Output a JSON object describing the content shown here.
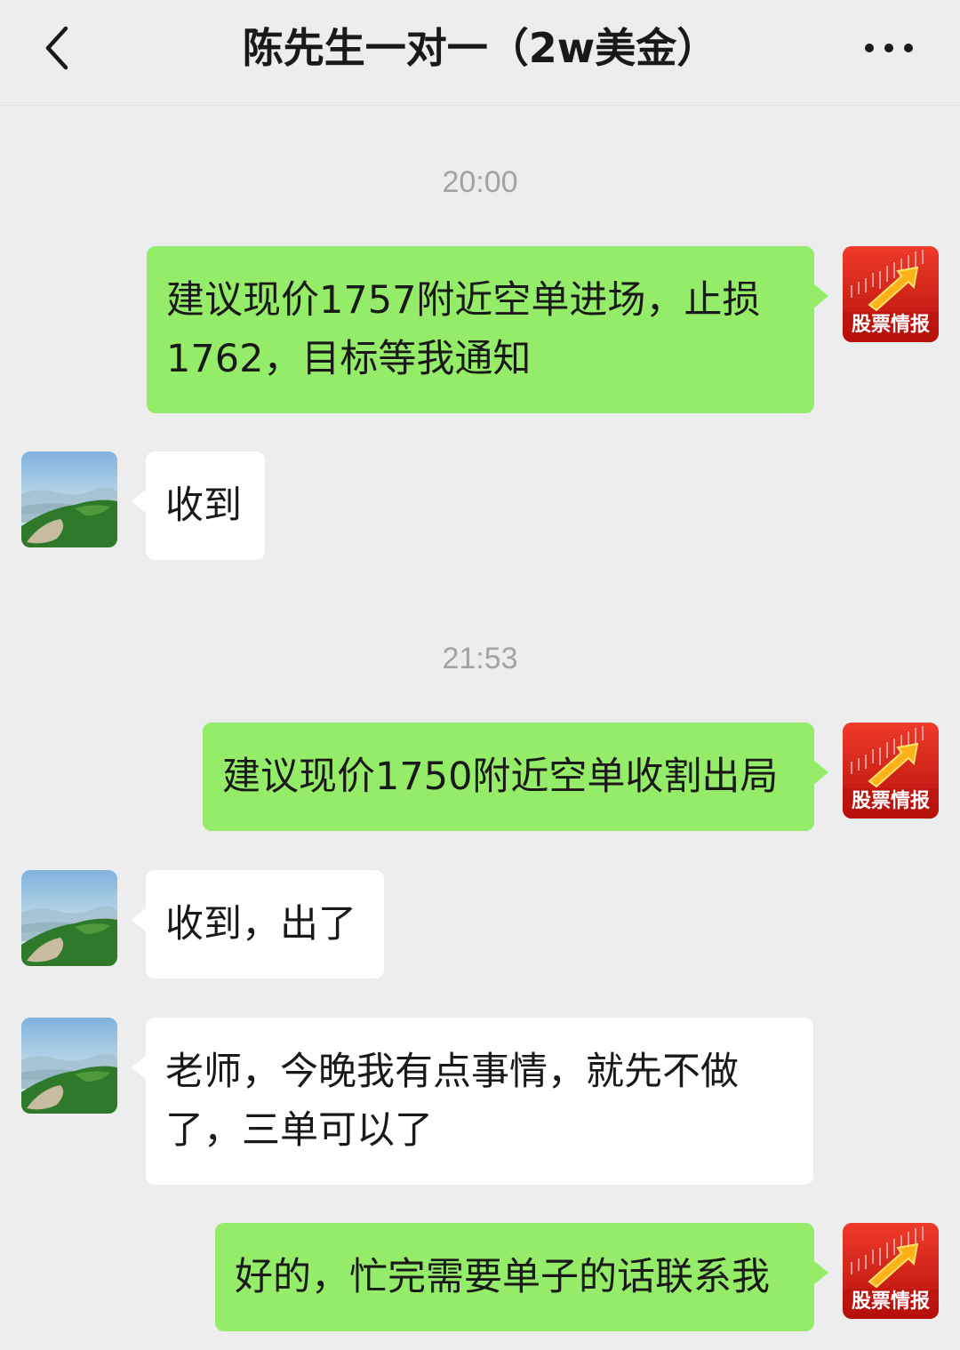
{
  "header": {
    "title": "陈先生一对一（2w美金）"
  },
  "stock_avatar_label": "股票情报",
  "messages": [
    {
      "type": "time",
      "text": "20:00"
    },
    {
      "type": "sent",
      "text": "建议现价1757附近空单进场，止损1762，目标等我通知"
    },
    {
      "type": "received",
      "text": "收到"
    },
    {
      "type": "time",
      "text": "21:53"
    },
    {
      "type": "sent",
      "text": "建议现价1750附近空单收割出局"
    },
    {
      "type": "received",
      "text": "收到，出了"
    },
    {
      "type": "received",
      "text": "老师，今晚我有点事情，就先不做了，三单可以了"
    },
    {
      "type": "sent",
      "text": "好的，忙完需要单子的话联系我"
    }
  ],
  "colors": {
    "background": "#ededed",
    "sent_bubble": "#95ec69",
    "received_bubble": "#ffffff",
    "time_text": "#a3a3a3",
    "avatar_red": "#e0201a"
  }
}
